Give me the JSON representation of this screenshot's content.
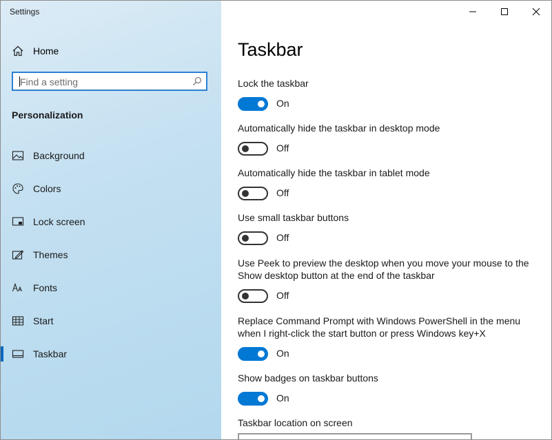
{
  "window": {
    "title": "Settings"
  },
  "sidebar": {
    "home": {
      "label": "Home",
      "icon": "home-icon"
    },
    "search": {
      "placeholder": "Find a setting",
      "icon": "search-icon"
    },
    "section": "Personalization",
    "items": [
      {
        "label": "Background",
        "icon": "picture-icon"
      },
      {
        "label": "Colors",
        "icon": "palette-icon"
      },
      {
        "label": "Lock screen",
        "icon": "lock-screen-icon"
      },
      {
        "label": "Themes",
        "icon": "themes-icon"
      },
      {
        "label": "Fonts",
        "icon": "fonts-icon"
      },
      {
        "label": "Start",
        "icon": "start-icon"
      },
      {
        "label": "Taskbar",
        "icon": "taskbar-icon",
        "active": true
      }
    ]
  },
  "main": {
    "title": "Taskbar",
    "settings": [
      {
        "description": "Lock the taskbar",
        "state": "On"
      },
      {
        "description": "Automatically hide the taskbar in desktop mode",
        "state": "Off"
      },
      {
        "description": "Automatically hide the taskbar in tablet mode",
        "state": "Off"
      },
      {
        "description": "Use small taskbar buttons",
        "state": "Off"
      },
      {
        "description_line1": "Use Peek to preview the desktop when you move your mouse to the",
        "description_line2": "Show desktop button at the end of the taskbar",
        "state": "Off"
      },
      {
        "description_line1": "Replace Command Prompt with Windows PowerShell in the menu",
        "description_line2": "when I right-click the start button or press Windows key+X",
        "state": "On"
      },
      {
        "description": "Show badges on taskbar buttons",
        "state": "On"
      }
    ],
    "location_label": "Taskbar location on screen"
  },
  "colors": {
    "accent": "#0078d4",
    "sidebar_bg": "#c4e0f1"
  }
}
